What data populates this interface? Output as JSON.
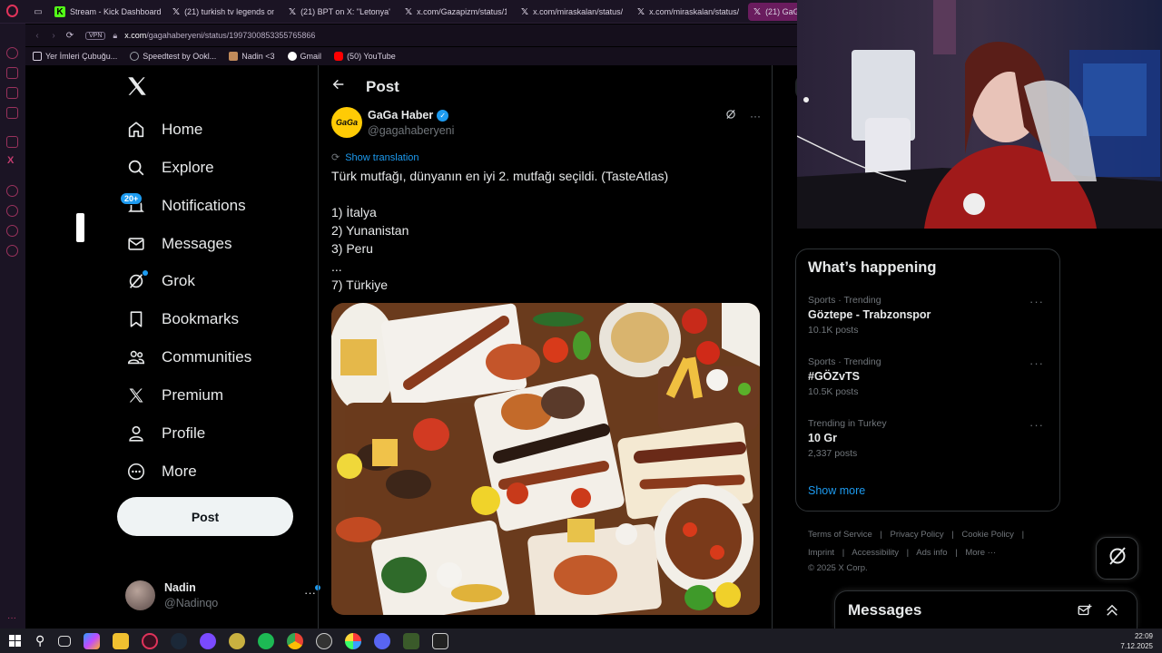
{
  "browser": {
    "tabs": [
      {
        "label": "",
        "icon": "photo-icon"
      },
      {
        "label": "Stream - Kick Dashboard",
        "icon": "kick-icon"
      },
      {
        "label": "(21) turkish tv legends on",
        "icon": "x-icon"
      },
      {
        "label": "(21) BPT on X: \"Letonya'd",
        "icon": "x-icon"
      },
      {
        "label": "x.com/Gazapizm/status/1",
        "icon": "x-icon"
      },
      {
        "label": "x.com/miraskalan/status/",
        "icon": "x-icon"
      },
      {
        "label": "x.com/miraskalan/status/",
        "icon": "x-icon"
      },
      {
        "label": "(21) GaGa",
        "icon": "x-icon"
      }
    ],
    "address": {
      "vpn": "VPN",
      "url_host": "x.com",
      "url_path": "/gagahaberyeni/status/1997300853355765866"
    },
    "bookmarks": [
      {
        "label": "Yer İmleri Çubuğu...",
        "color": "#d8d0e0"
      },
      {
        "label": "Speedtest by Ookl...",
        "color": "#9aa0a6"
      },
      {
        "label": "Nadin <3",
        "color": "#c08a5a"
      },
      {
        "label": "Gmail",
        "color": "#ea4335"
      },
      {
        "label": "(50) YouTube",
        "color": "#ff0000"
      }
    ]
  },
  "sidebar": {
    "items": [
      {
        "label": "Home",
        "icon": "home-icon"
      },
      {
        "label": "Explore",
        "icon": "search-icon"
      },
      {
        "label": "Notifications",
        "icon": "bell-icon"
      },
      {
        "label": "Messages",
        "icon": "mail-icon"
      },
      {
        "label": "Grok",
        "icon": "grok-icon"
      },
      {
        "label": "Bookmarks",
        "icon": "bookmark-icon"
      },
      {
        "label": "Communities",
        "icon": "communities-icon"
      },
      {
        "label": "Premium",
        "icon": "x-logo-icon"
      },
      {
        "label": "Profile",
        "icon": "person-icon"
      },
      {
        "label": "More",
        "icon": "more-circle-icon"
      }
    ],
    "notifications_badge": "20+",
    "post_button": "Post",
    "user": {
      "name": "Nadin",
      "handle": "@Nadinqo",
      "more": "···"
    }
  },
  "post": {
    "header_title": "Post",
    "author_name": "GaGa Haber",
    "author_handle": "@gagahaberyeni",
    "avatar_text": "GaGa",
    "show_translation": "Show translation",
    "text_lines": [
      "Türk mutfağı, dünyanın en iyi 2. mutfağı seçildi. (TasteAtlas)",
      "",
      "1) İtalya",
      "2) Yunanistan",
      "3) Peru",
      "...",
      "7) Türkiye"
    ]
  },
  "trends": {
    "title": "What’s happening",
    "items": [
      {
        "meta": "Sports · Trending",
        "name": "Göztepe - Trabzonspor",
        "count": "10.1K posts"
      },
      {
        "meta": "Sports · Trending",
        "name": "#GÖZvTS",
        "count": "10.5K posts"
      },
      {
        "meta": "Trending in Turkey",
        "name": "10 Gr",
        "count": "2,337 posts"
      }
    ],
    "show_more": "Show more"
  },
  "footer": {
    "row1": [
      "Terms of Service",
      "|",
      "Privacy Policy",
      "|",
      "Cookie Policy",
      "|"
    ],
    "row2": [
      "Imprint",
      "|",
      "Accessibility",
      "|",
      "Ads info",
      "|",
      "More ···"
    ],
    "copyright": "© 2025 X Corp."
  },
  "messages_dock": {
    "title": "Messages"
  },
  "taskbar": {
    "time": "22:09",
    "date": "7.12.2025"
  },
  "colors": {
    "accent": "#1d9bf0",
    "browser_chrome": "#1b1424",
    "active_tab": "#6a1c5e",
    "brand_yellow": "#ffcb05"
  }
}
